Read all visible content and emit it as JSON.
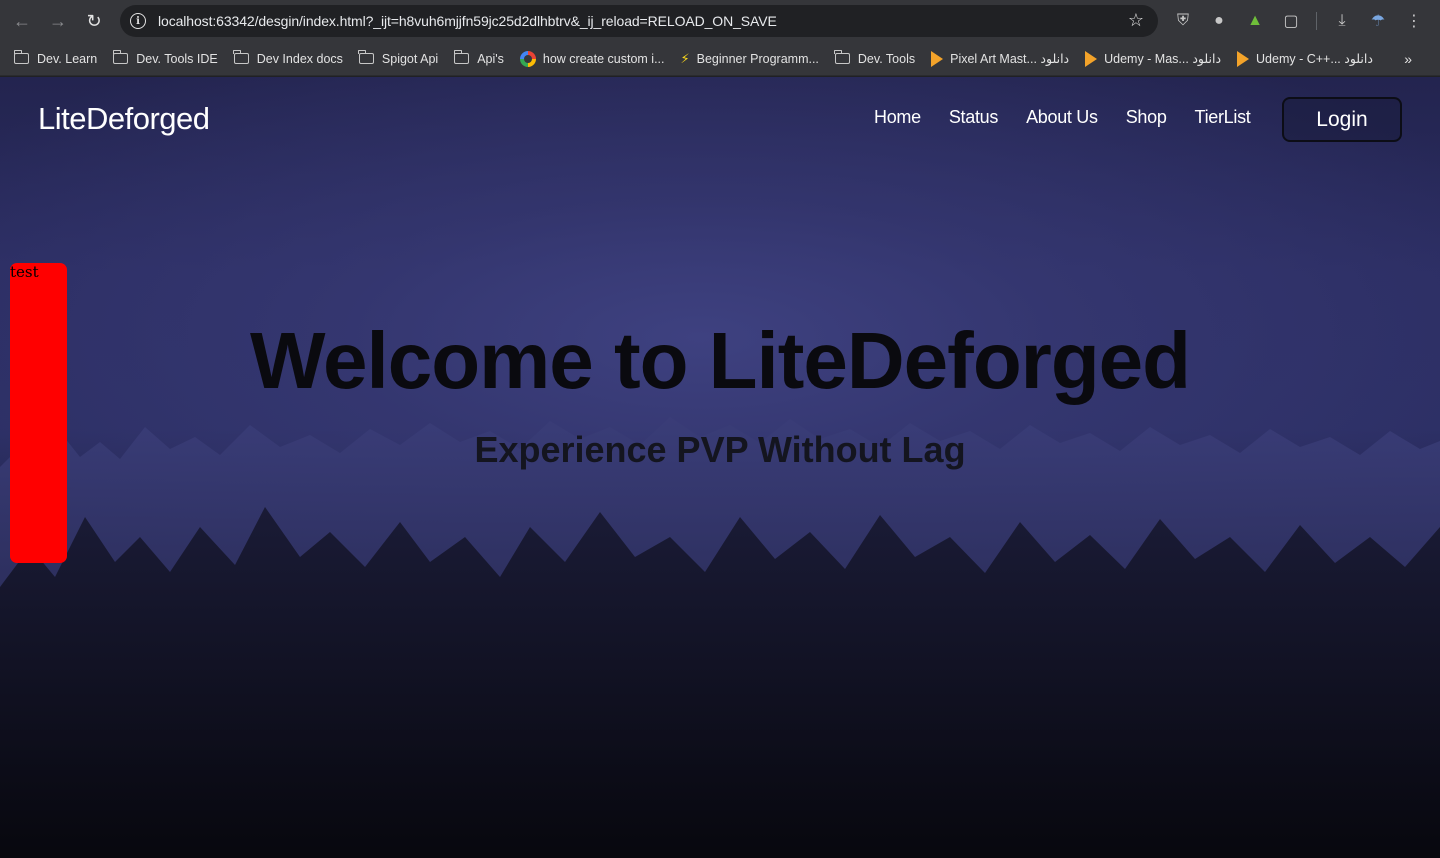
{
  "browser": {
    "url": "localhost:63342/desgin/index.html?_ijt=h8vuh6mjjfn59jc25d2dlhbtrv&_ij_reload=RELOAD_ON_SAVE",
    "bookmarks": [
      {
        "label": "Dev. Learn",
        "icon": "folder-icon"
      },
      {
        "label": "Dev. Tools IDE",
        "icon": "folder-icon"
      },
      {
        "label": "Dev Index docs",
        "icon": "folder-icon"
      },
      {
        "label": "Spigot Api",
        "icon": "folder-icon"
      },
      {
        "label": "Api's",
        "icon": "folder-icon"
      },
      {
        "label": "how create custom i...",
        "icon": "google-icon"
      },
      {
        "label": "Beginner Programm...",
        "icon": "bolt-icon"
      },
      {
        "label": "Dev. Tools",
        "icon": "folder-icon"
      },
      {
        "label": "Pixel Art Mast... دانلود",
        "icon": "play-icon"
      },
      {
        "label": "Udemy - Mas... دانلود",
        "icon": "play-icon"
      },
      {
        "label": "Udemy - C++... دانلود",
        "icon": "play-icon"
      }
    ]
  },
  "site": {
    "logo": "LiteDeforged",
    "nav": [
      "Home",
      "Status",
      "About Us",
      "Shop",
      "TierList"
    ],
    "login_label": "Login",
    "side_panel_text": "test",
    "hero_title": "Welcome to LiteDeforged",
    "hero_subtitle": "Experience PVP Without Lag"
  },
  "colors": {
    "side_panel": "#ff0000",
    "sky_top": "#23244f",
    "sky_glow": "#3e4180",
    "hero_text": "#0a0a0f"
  }
}
